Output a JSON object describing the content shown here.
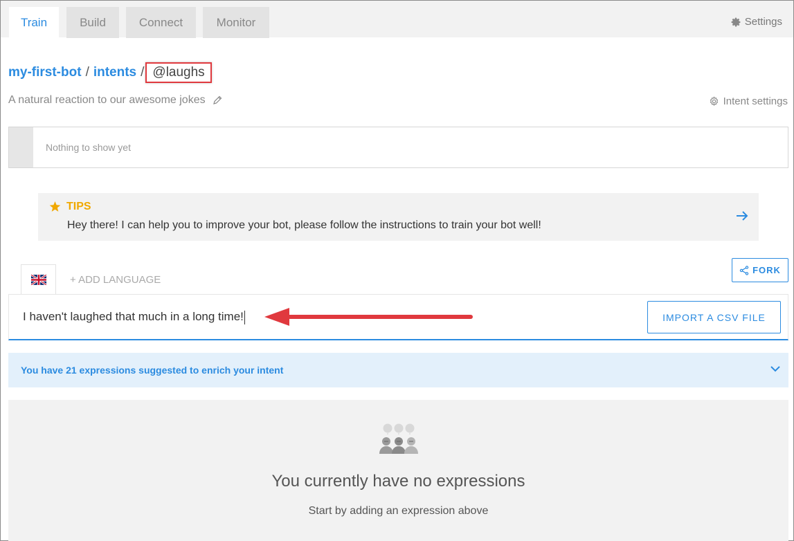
{
  "tabs": [
    {
      "label": "Train",
      "active": true
    },
    {
      "label": "Build",
      "active": false
    },
    {
      "label": "Connect",
      "active": false
    },
    {
      "label": "Monitor",
      "active": false
    }
  ],
  "settings_label": "Settings",
  "breadcrumb": {
    "bot": "my-first-bot",
    "separator": "/",
    "intents": "intents",
    "current": "@laughs"
  },
  "intent": {
    "description": "A natural reaction to our awesome jokes",
    "settings_label": "Intent settings"
  },
  "empty_box_text": "Nothing to show yet",
  "tips": {
    "title": "TIPS",
    "body": "Hey there! I can help you to improve your bot, please follow the instructions to train your bot well!"
  },
  "language": {
    "current_flag": "uk-flag-icon",
    "add_label": "+ ADD LANGUAGE"
  },
  "fork_label": "FORK",
  "expression_input": {
    "value": "I haven't laughed that much in a long time!"
  },
  "import_csv_label": "IMPORT A CSV FILE",
  "suggestions_text": "You have 21 expressions suggested to enrich your intent",
  "empty_state": {
    "title": "You currently have no expressions",
    "subtitle": "Start by adding an expression above"
  },
  "colors": {
    "accent": "#2b8be0",
    "tips": "#f0a800",
    "annotation": "#e0393e"
  }
}
